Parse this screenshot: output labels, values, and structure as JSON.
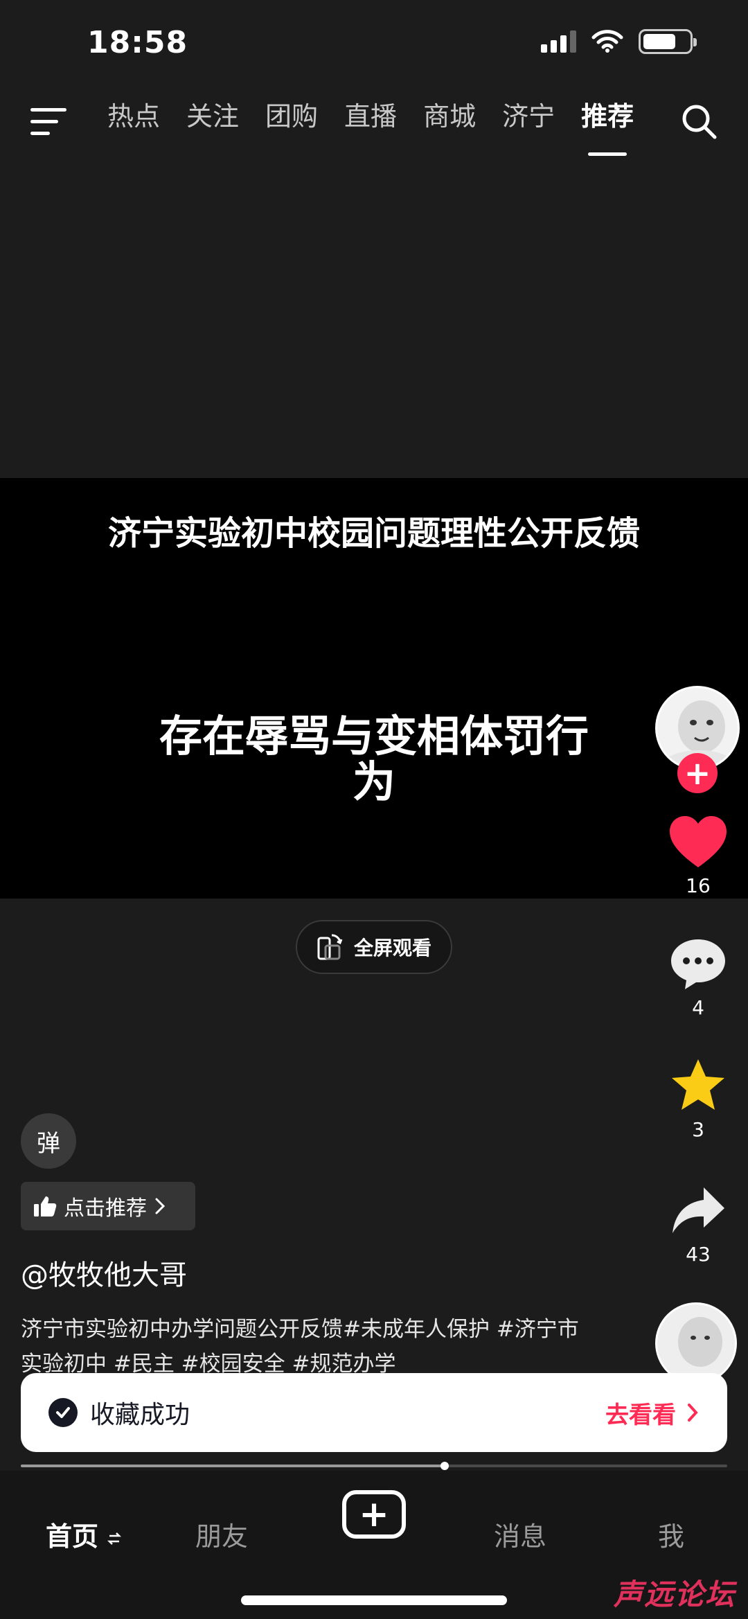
{
  "status_bar": {
    "time": "18:58",
    "battery_level": 0.72
  },
  "top_nav": {
    "tabs": [
      "热点",
      "关注",
      "团购",
      "直播",
      "商城",
      "济宁",
      "推荐"
    ],
    "active_tab": "推荐"
  },
  "video": {
    "title": "济宁实验初中校园问题理性公开反馈",
    "subtitle": "存在辱骂与变相体罚行为",
    "fullscreen_label": "全屏观看"
  },
  "actions": {
    "likes": "16",
    "comments": "4",
    "favorites": "3",
    "shares": "43"
  },
  "colors": {
    "accent": "#fe2c55",
    "like": "#fe2c55",
    "favorite": "#facc15"
  },
  "info": {
    "danmu_label": "弹",
    "recommend_label": "点击推荐",
    "author": "@牧牧他大哥",
    "description": "济宁市实验初中办学问题公开反馈#未成年人保护 #济宁市实验初中 #民主 #校园安全 #规范办学"
  },
  "toast": {
    "text": "收藏成功",
    "action": "去看看"
  },
  "progress": 0.6,
  "bottom_nav": {
    "home": "首页",
    "friends": "朋友",
    "messages": "消息",
    "me": "我"
  },
  "watermark": "声远论坛"
}
